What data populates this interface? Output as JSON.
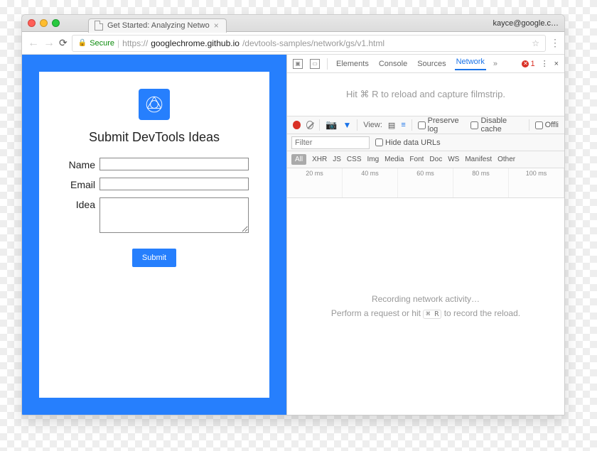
{
  "browser": {
    "tab_title": "Get Started: Analyzing Netwo",
    "user": "kayce@google.c…",
    "addressbar": {
      "secure": "Secure",
      "scheme": "https://",
      "host": "googlechrome.github.io",
      "path": "/devtools-samples/network/gs/v1.html"
    }
  },
  "page": {
    "title": "Submit DevTools Ideas",
    "labels": {
      "name": "Name",
      "email": "Email",
      "idea": "Idea"
    },
    "submit": "Submit"
  },
  "devtools": {
    "tabs": [
      "Elements",
      "Console",
      "Sources",
      "Network"
    ],
    "active_tab": "Network",
    "error_count": "1",
    "filmstrip_hint": "Hit ⌘ R to reload and capture filmstrip.",
    "toolbar": {
      "view_label": "View:",
      "preserve_log": "Preserve log",
      "disable_cache": "Disable cache",
      "offline": "Offli"
    },
    "filter": {
      "placeholder": "Filter",
      "hide_data_urls": "Hide data URLs"
    },
    "types": [
      "All",
      "XHR",
      "JS",
      "CSS",
      "Img",
      "Media",
      "Font",
      "Doc",
      "WS",
      "Manifest",
      "Other"
    ],
    "timeline": [
      "20 ms",
      "40 ms",
      "60 ms",
      "80 ms",
      "100 ms"
    ],
    "recording_msg": "Recording network activity…",
    "perform_msg_pre": "Perform a request or hit ",
    "perform_msg_cmd": "⌘ R",
    "perform_msg_post": " to record the reload."
  }
}
